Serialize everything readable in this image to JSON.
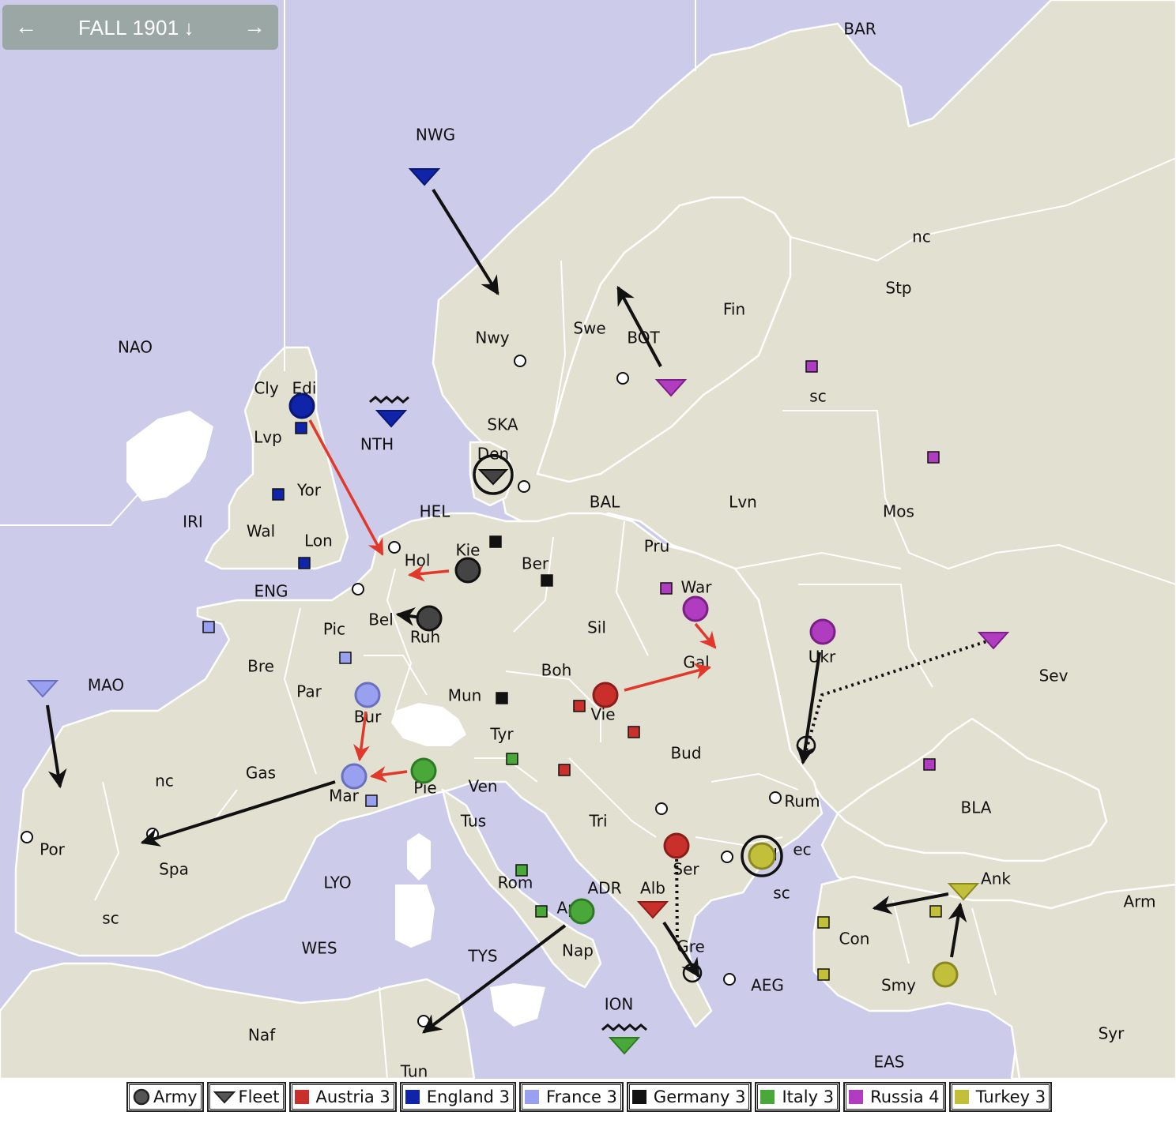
{
  "phase": {
    "title": "FALL 1901",
    "prev_icon": "arrow-left-icon",
    "next_icon": "arrow-right-icon",
    "down_icon": "arrow-down-icon"
  },
  "map": {
    "labels": [
      {
        "id": "BAR",
        "text": "BAR"
      },
      {
        "id": "NWG",
        "text": "NWG"
      },
      {
        "id": "NAO",
        "text": "NAO"
      },
      {
        "id": "STP_NC",
        "text": "nc"
      },
      {
        "id": "STP",
        "text": "Stp"
      },
      {
        "id": "FIN",
        "text": "Fin"
      },
      {
        "id": "NWY",
        "text": "Nwy"
      },
      {
        "id": "SWE",
        "text": "Swe"
      },
      {
        "id": "BOT",
        "text": "BOT"
      },
      {
        "id": "STP_SC",
        "text": "sc"
      },
      {
        "id": "CLY",
        "text": "Cly"
      },
      {
        "id": "EDI",
        "text": "Edi"
      },
      {
        "id": "LVP",
        "text": "Lvp"
      },
      {
        "id": "NTH",
        "text": "NTH"
      },
      {
        "id": "SKA",
        "text": "SKA"
      },
      {
        "id": "DEN",
        "text": "Den"
      },
      {
        "id": "YOR",
        "text": "Yor"
      },
      {
        "id": "BAL",
        "text": "BAL"
      },
      {
        "id": "LVN",
        "text": "Lvn"
      },
      {
        "id": "MOS",
        "text": "Mos"
      },
      {
        "id": "HEL",
        "text": "HEL"
      },
      {
        "id": "IRI",
        "text": "IRI"
      },
      {
        "id": "WAL",
        "text": "Wal"
      },
      {
        "id": "LON",
        "text": "Lon"
      },
      {
        "id": "KIE",
        "text": "Kie"
      },
      {
        "id": "PRU",
        "text": "Pru"
      },
      {
        "id": "HOL",
        "text": "Hol"
      },
      {
        "id": "BER",
        "text": "Ber"
      },
      {
        "id": "ENG",
        "text": "ENG"
      },
      {
        "id": "WAR",
        "text": "War"
      },
      {
        "id": "BEL",
        "text": "Bel"
      },
      {
        "id": "RUH",
        "text": "Ruh"
      },
      {
        "id": "PIC",
        "text": "Pic"
      },
      {
        "id": "SIL",
        "text": "Sil"
      },
      {
        "id": "UKR",
        "text": "Ukr"
      },
      {
        "id": "BRE",
        "text": "Bre"
      },
      {
        "id": "GAL",
        "text": "Gal"
      },
      {
        "id": "SEV",
        "text": "Sev"
      },
      {
        "id": "MAO",
        "text": "MAO"
      },
      {
        "id": "BOH",
        "text": "Boh"
      },
      {
        "id": "PAR",
        "text": "Par"
      },
      {
        "id": "MUN",
        "text": "Mun"
      },
      {
        "id": "BUR",
        "text": "Bur"
      },
      {
        "id": "VIE",
        "text": "Vie"
      },
      {
        "id": "TYR",
        "text": "Tyr"
      },
      {
        "id": "BUD",
        "text": "Bud"
      },
      {
        "id": "GAS",
        "text": "Gas"
      },
      {
        "id": "SPA_NC",
        "text": "nc"
      },
      {
        "id": "VEN",
        "text": "Ven"
      },
      {
        "id": "PIE",
        "text": "Pie"
      },
      {
        "id": "MAR",
        "text": "Mar"
      },
      {
        "id": "BLA",
        "text": "BLA"
      },
      {
        "id": "RUM",
        "text": "Rum"
      },
      {
        "id": "TUS",
        "text": "Tus"
      },
      {
        "id": "TRI",
        "text": "Tri"
      },
      {
        "id": "POR",
        "text": "Por"
      },
      {
        "id": "SPA",
        "text": "Spa"
      },
      {
        "id": "BUL_EC",
        "text": "ec"
      },
      {
        "id": "BUL",
        "text": "Bul"
      },
      {
        "id": "SER",
        "text": "Ser"
      },
      {
        "id": "LYO",
        "text": "LYO"
      },
      {
        "id": "ROM",
        "text": "Rom"
      },
      {
        "id": "ADR",
        "text": "ADR"
      },
      {
        "id": "ALB",
        "text": "Alb"
      },
      {
        "id": "ANK",
        "text": "Ank"
      },
      {
        "id": "ARM",
        "text": "Arm"
      },
      {
        "id": "SPA_SC",
        "text": "sc"
      },
      {
        "id": "BUL_SC",
        "text": "sc"
      },
      {
        "id": "CON",
        "text": "Con"
      },
      {
        "id": "WES",
        "text": "WES"
      },
      {
        "id": "TYS",
        "text": "TYS"
      },
      {
        "id": "APU",
        "text": "Apu"
      },
      {
        "id": "NAP",
        "text": "Nap"
      },
      {
        "id": "GRE",
        "text": "Gre"
      },
      {
        "id": "AEG",
        "text": "AEG"
      },
      {
        "id": "SMY",
        "text": "Smy"
      },
      {
        "id": "ION",
        "text": "ION"
      },
      {
        "id": "NAF",
        "text": "Naf"
      },
      {
        "id": "SYR",
        "text": "Syr"
      },
      {
        "id": "EAS",
        "text": "EAS"
      },
      {
        "id": "TUN",
        "text": "Tun"
      }
    ],
    "colors": {
      "sea": "#ccccea",
      "land": "#e2e0d1",
      "border": "#ffffff",
      "austria": "#c9302c",
      "england": "#0f24a8",
      "france": "#9aa0f0",
      "germany": "#111111",
      "italy": "#4aa83a",
      "russia": "#b03cbf",
      "turkey": "#c2c03a",
      "move_order": "#111111",
      "failed_order": "#e0392b"
    }
  },
  "legend": {
    "army": "Army",
    "fleet": "Fleet",
    "items": [
      {
        "label": "Austria 3",
        "color": "#c9302c"
      },
      {
        "label": "England 3",
        "color": "#0f24a8"
      },
      {
        "label": "France 3",
        "color": "#9aa0f0"
      },
      {
        "label": "Germany 3",
        "color": "#111111"
      },
      {
        "label": "Italy 3",
        "color": "#4aa83a"
      },
      {
        "label": "Russia 4",
        "color": "#b03cbf"
      },
      {
        "label": "Turkey 3",
        "color": "#c2c03a"
      }
    ]
  }
}
